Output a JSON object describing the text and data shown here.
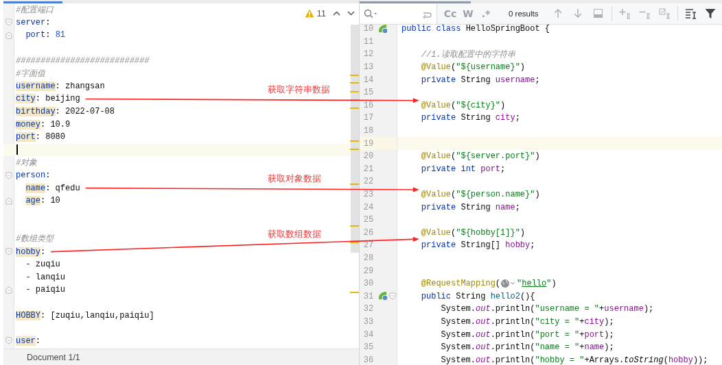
{
  "left_editor": {
    "inspection": {
      "warnings": "11"
    },
    "lines": [
      {
        "kind": "code",
        "tokens": [
          {
            "kind": "comment",
            "text": "#配置端口"
          }
        ]
      },
      {
        "kind": "code",
        "fold_start": true,
        "tokens": [
          {
            "kind": "key",
            "text": "server"
          },
          {
            "kind": "plain",
            "text": ":"
          }
        ]
      },
      {
        "kind": "code",
        "fold_end": true,
        "tokens": [
          {
            "kind": "key",
            "text": "  port"
          },
          {
            "kind": "plain",
            "text": ": "
          },
          {
            "kind": "number",
            "text": "81"
          }
        ]
      },
      {
        "kind": "blank"
      },
      {
        "kind": "code",
        "tokens": [
          {
            "kind": "comment",
            "text": "###########################"
          }
        ]
      },
      {
        "kind": "code",
        "tokens": [
          {
            "kind": "comment",
            "text": "#字面值"
          }
        ]
      },
      {
        "kind": "code",
        "tokens": [
          {
            "kind": "key_marked",
            "text": "username"
          },
          {
            "kind": "plain",
            "text": ": zhangsan"
          }
        ]
      },
      {
        "kind": "code",
        "tokens": [
          {
            "kind": "key_marked",
            "text": "city"
          },
          {
            "kind": "plain",
            "text": ": beijing"
          }
        ]
      },
      {
        "kind": "code",
        "tokens": [
          {
            "kind": "key_marked",
            "text": "birthday"
          },
          {
            "kind": "plain",
            "text": ": 2022-07-08"
          }
        ]
      },
      {
        "kind": "code",
        "tokens": [
          {
            "kind": "key_marked",
            "text": "money"
          },
          {
            "kind": "plain",
            "text": ": 10.9"
          }
        ]
      },
      {
        "kind": "code",
        "tokens": [
          {
            "kind": "key_marked",
            "text": "port"
          },
          {
            "kind": "plain",
            "text": ": 8080"
          }
        ]
      },
      {
        "kind": "blank",
        "current": true
      },
      {
        "kind": "code",
        "tokens": [
          {
            "kind": "comment",
            "text": "#对象"
          }
        ]
      },
      {
        "kind": "code",
        "fold_start": true,
        "tokens": [
          {
            "kind": "key",
            "text": "person"
          },
          {
            "kind": "plain",
            "text": ":"
          }
        ]
      },
      {
        "kind": "code",
        "tokens": [
          {
            "kind": "key_marked",
            "text": "  name"
          },
          {
            "kind": "plain",
            "text": ": qfedu"
          }
        ]
      },
      {
        "kind": "code",
        "fold_end": true,
        "tokens": [
          {
            "kind": "key_marked",
            "text": "  age"
          },
          {
            "kind": "plain",
            "text": ": 10"
          }
        ]
      },
      {
        "kind": "blank"
      },
      {
        "kind": "blank"
      },
      {
        "kind": "code",
        "tokens": [
          {
            "kind": "comment",
            "text": "#数组类型"
          }
        ]
      },
      {
        "kind": "code",
        "fold_start": true,
        "tokens": [
          {
            "kind": "key_marked",
            "text": "hobby"
          },
          {
            "kind": "plain",
            "text": ":"
          }
        ]
      },
      {
        "kind": "code",
        "tokens": [
          {
            "kind": "plain",
            "text": "  - zuqiu"
          }
        ]
      },
      {
        "kind": "code",
        "tokens": [
          {
            "kind": "plain",
            "text": "  - lanqiu"
          }
        ]
      },
      {
        "kind": "code",
        "fold_end": true,
        "tokens": [
          {
            "kind": "plain",
            "text": "  - paiqiu"
          }
        ]
      },
      {
        "kind": "blank"
      },
      {
        "kind": "code",
        "tokens": [
          {
            "kind": "key_marked",
            "text": "HOBBY"
          },
          {
            "kind": "plain",
            "text": ": [zuqiu,lanqiu,paiqiu]"
          }
        ]
      },
      {
        "kind": "blank"
      },
      {
        "kind": "code",
        "fold_start": true,
        "tokens": [
          {
            "kind": "key_marked",
            "text": "user"
          },
          {
            "kind": "plain",
            "text": ":"
          }
        ]
      }
    ],
    "status_bar": "Document 1/1"
  },
  "right_editor": {
    "search_bar": {
      "options": [
        "Cc",
        "W",
        ".*"
      ],
      "results": "0 results"
    },
    "lines": [
      {
        "number": "10",
        "bean_marker": true,
        "tokens": [
          {
            "kind": "keyword",
            "text": "public"
          },
          {
            "kind": "keyword",
            "text": " class"
          },
          {
            "kind": "plain",
            "text": " HelloSpringBoot {"
          }
        ]
      },
      {
        "number": "11"
      },
      {
        "number": "12",
        "tokens": [
          {
            "kind": "comment",
            "text": "    //1.读取配置中的字符串"
          }
        ]
      },
      {
        "number": "13",
        "tokens": [
          {
            "kind": "annotation",
            "text": "    @Value"
          },
          {
            "kind": "plain",
            "text": "("
          },
          {
            "kind": "string",
            "text": "\"${username}\""
          },
          {
            "kind": "plain",
            "text": ")"
          }
        ]
      },
      {
        "number": "14",
        "tokens": [
          {
            "kind": "keyword",
            "text": "    private"
          },
          {
            "kind": "plain",
            "text": " String "
          },
          {
            "kind": "field",
            "text": "username"
          },
          {
            "kind": "plain",
            "text": ";"
          }
        ]
      },
      {
        "number": "15"
      },
      {
        "number": "16",
        "tokens": [
          {
            "kind": "annotation",
            "text": "    @Value"
          },
          {
            "kind": "plain",
            "text": "("
          },
          {
            "kind": "string",
            "text": "\"${city}\""
          },
          {
            "kind": "plain",
            "text": ")"
          }
        ]
      },
      {
        "number": "17",
        "tokens": [
          {
            "kind": "keyword",
            "text": "    private"
          },
          {
            "kind": "plain",
            "text": " String "
          },
          {
            "kind": "field",
            "text": "city"
          },
          {
            "kind": "plain",
            "text": ";"
          }
        ]
      },
      {
        "number": "18"
      },
      {
        "number": "19",
        "current": true
      },
      {
        "number": "20",
        "tokens": [
          {
            "kind": "annotation",
            "text": "    @Value"
          },
          {
            "kind": "plain",
            "text": "("
          },
          {
            "kind": "string",
            "text": "\"${server.port}\""
          },
          {
            "kind": "plain",
            "text": ")"
          }
        ]
      },
      {
        "number": "21",
        "tokens": [
          {
            "kind": "keyword",
            "text": "    private"
          },
          {
            "kind": "keyword",
            "text": " int"
          },
          {
            "kind": "field",
            "text": " port"
          },
          {
            "kind": "plain",
            "text": ";"
          }
        ]
      },
      {
        "number": "22"
      },
      {
        "number": "23",
        "tokens": [
          {
            "kind": "annotation",
            "text": "    @Value"
          },
          {
            "kind": "plain",
            "text": "("
          },
          {
            "kind": "string",
            "text": "\"${person.name}\""
          },
          {
            "kind": "plain",
            "text": ")"
          }
        ]
      },
      {
        "number": "24",
        "tokens": [
          {
            "kind": "keyword",
            "text": "    private"
          },
          {
            "kind": "plain",
            "text": " String "
          },
          {
            "kind": "field",
            "text": "name"
          },
          {
            "kind": "plain",
            "text": ";"
          }
        ]
      },
      {
        "number": "25"
      },
      {
        "number": "26",
        "tokens": [
          {
            "kind": "annotation",
            "text": "    @Value"
          },
          {
            "kind": "plain",
            "text": "("
          },
          {
            "kind": "string",
            "text": "\"${hobby[1]}\""
          },
          {
            "kind": "plain",
            "text": ")"
          }
        ]
      },
      {
        "number": "27",
        "tokens": [
          {
            "kind": "keyword",
            "text": "    private"
          },
          {
            "kind": "plain",
            "text": " String[] "
          },
          {
            "kind": "field",
            "text": "hobby"
          },
          {
            "kind": "plain",
            "text": ";"
          }
        ]
      },
      {
        "number": "28"
      },
      {
        "number": "29"
      },
      {
        "number": "30",
        "tokens": [
          {
            "kind": "annotation",
            "text": "    @RequestMapping"
          },
          {
            "kind": "plain",
            "text": "("
          },
          {
            "kind": "globe_icon"
          },
          {
            "kind": "string",
            "text": "\""
          },
          {
            "kind": "string_link",
            "text": "hello"
          },
          {
            "kind": "string",
            "text": "\""
          },
          {
            "kind": "plain",
            "text": ")"
          }
        ]
      },
      {
        "number": "31",
        "bean_marker": true,
        "fold_start": true,
        "tokens": [
          {
            "kind": "keyword",
            "text": "    public"
          },
          {
            "kind": "plain",
            "text": " String "
          },
          {
            "kind": "method",
            "text": "hello2"
          },
          {
            "kind": "plain",
            "text": "(){"
          }
        ]
      },
      {
        "number": "32",
        "tokens": [
          {
            "kind": "plain",
            "text": "        System."
          },
          {
            "kind": "static",
            "text": "out"
          },
          {
            "kind": "plain",
            "text": ".println("
          },
          {
            "kind": "string",
            "text": "\"username = \""
          },
          {
            "kind": "plain",
            "text": "+"
          },
          {
            "kind": "field",
            "text": "username"
          },
          {
            "kind": "plain",
            "text": ");"
          }
        ]
      },
      {
        "number": "33",
        "tokens": [
          {
            "kind": "plain",
            "text": "        System."
          },
          {
            "kind": "static",
            "text": "out"
          },
          {
            "kind": "plain",
            "text": ".println("
          },
          {
            "kind": "string",
            "text": "\"city = \""
          },
          {
            "kind": "plain",
            "text": "+"
          },
          {
            "kind": "field",
            "text": "city"
          },
          {
            "kind": "plain",
            "text": ");"
          }
        ]
      },
      {
        "number": "34",
        "tokens": [
          {
            "kind": "plain",
            "text": "        System."
          },
          {
            "kind": "static",
            "text": "out"
          },
          {
            "kind": "plain",
            "text": ".println("
          },
          {
            "kind": "string",
            "text": "\"port = \""
          },
          {
            "kind": "plain",
            "text": "+"
          },
          {
            "kind": "field",
            "text": "port"
          },
          {
            "kind": "plain",
            "text": ");"
          }
        ]
      },
      {
        "number": "35",
        "tokens": [
          {
            "kind": "plain",
            "text": "        System."
          },
          {
            "kind": "static",
            "text": "out"
          },
          {
            "kind": "plain",
            "text": ".println("
          },
          {
            "kind": "string",
            "text": "\"name = \""
          },
          {
            "kind": "plain",
            "text": "+"
          },
          {
            "kind": "field",
            "text": "name"
          },
          {
            "kind": "plain",
            "text": ");"
          }
        ]
      },
      {
        "number": "36",
        "tokens": [
          {
            "kind": "plain",
            "text": "        System."
          },
          {
            "kind": "static",
            "text": "out"
          },
          {
            "kind": "plain",
            "text": ".println("
          },
          {
            "kind": "string",
            "text": "\"hobby = \""
          },
          {
            "kind": "plain",
            "text": "+Arrays."
          },
          {
            "kind": "static_method",
            "text": "toString"
          },
          {
            "kind": "plain",
            "text": "("
          },
          {
            "kind": "field",
            "text": "hobby"
          },
          {
            "kind": "plain",
            "text": "));"
          }
        ]
      }
    ]
  },
  "annotations": [
    {
      "label": "获取字符串数据"
    },
    {
      "label": "获取对象数据"
    },
    {
      "label": "获取数组数据"
    }
  ]
}
